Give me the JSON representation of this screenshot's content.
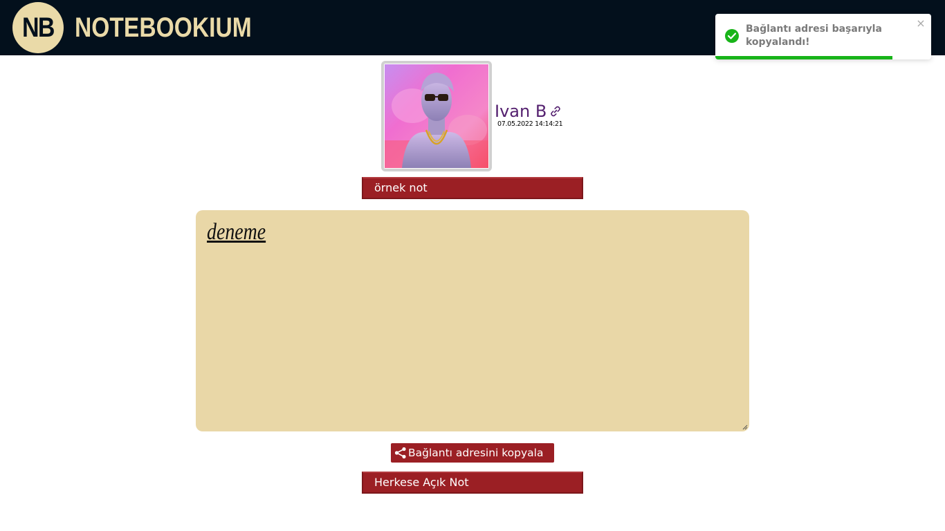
{
  "header": {
    "logo_initials": "NB",
    "brand": "NOTEBOOKIUM"
  },
  "toast": {
    "message": "Bağlantı adresi başarıyla kopyalandı!",
    "close_label": "×",
    "progress": 0.82,
    "icon": "check-circle-icon",
    "color": "#18b419"
  },
  "author": {
    "name": "Ivan B",
    "timestamp": "07.05.2022 14:14:21",
    "avatar_icon": "avatar-image",
    "link_icon": "link-icon"
  },
  "note": {
    "title": "örnek not",
    "content": "deneme",
    "visibility": "Herkese Açık Not"
  },
  "actions": {
    "copy_link_label": "Bağlantı adresini kopyala",
    "share_icon": "share-icon"
  },
  "colors": {
    "header_bg": "#03101c",
    "brand": "#eadaa8",
    "accent": "#9b1f24",
    "note_bg": "#e9d7a7",
    "username": "#54206f"
  }
}
